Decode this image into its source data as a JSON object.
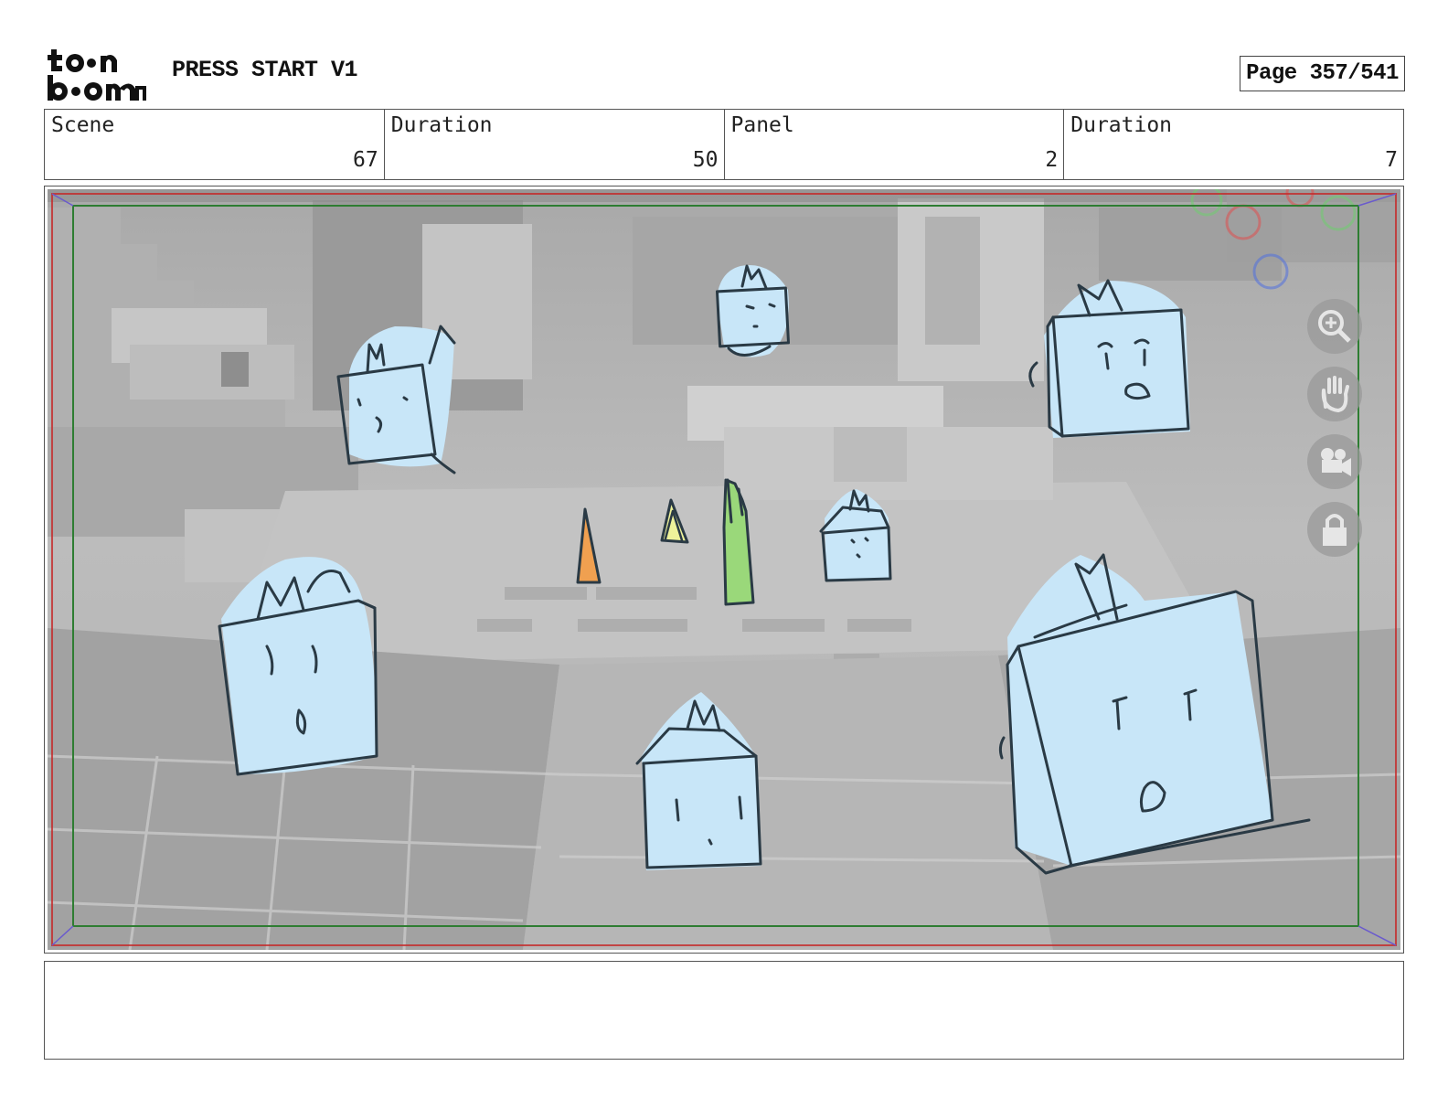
{
  "header": {
    "logo_text": "toonboom",
    "project_title": "PRESS START V1",
    "page_label": "Page 357/541"
  },
  "info": {
    "scene_label": "Scene",
    "scene_value": "67",
    "scene_duration_label": "Duration",
    "scene_duration_value": "50",
    "panel_label": "Panel",
    "panel_value": "2",
    "panel_duration_label": "Duration",
    "panel_duration_value": "7"
  },
  "panel": {
    "colors": {
      "sketch_fill": "#c8e6f8",
      "sketch_stroke": "#2a3a45",
      "background_grey": "#bdbdbd",
      "safe_frame": "#2e7d32",
      "outer_frame": "#c62828",
      "orange_marker": "#f0a050",
      "yellow_marker": "#eef29a",
      "green_marker": "#9ad87a"
    },
    "overlay_icons": [
      "zoom-in-icon",
      "hand-icon",
      "camera-icon",
      "lock-icon"
    ]
  },
  "notes": {
    "text": ""
  }
}
